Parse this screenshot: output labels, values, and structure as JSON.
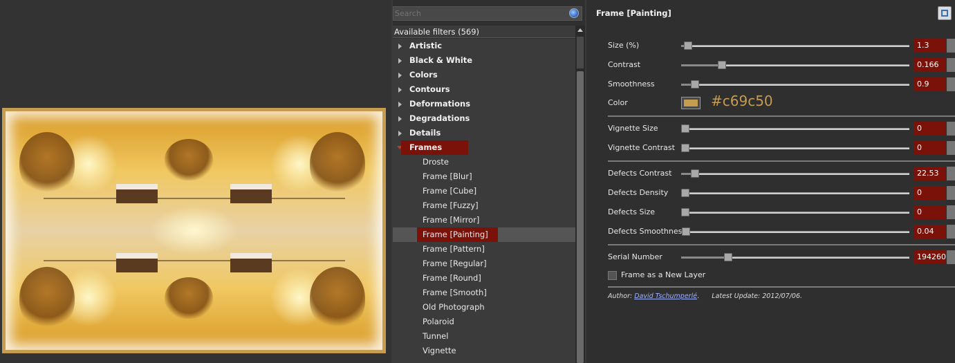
{
  "search": {
    "placeholder": "Search"
  },
  "filters": {
    "header": "Available filters (569)",
    "categories": [
      {
        "label": "Artistic"
      },
      {
        "label": "Black & White"
      },
      {
        "label": "Colors"
      },
      {
        "label": "Contours"
      },
      {
        "label": "Deformations"
      },
      {
        "label": "Degradations"
      },
      {
        "label": "Details"
      },
      {
        "label": "Frames"
      }
    ],
    "frames_items": [
      {
        "label": "Droste"
      },
      {
        "label": "Frame [Blur]"
      },
      {
        "label": "Frame [Cube]"
      },
      {
        "label": "Frame [Fuzzy]"
      },
      {
        "label": "Frame [Mirror]"
      },
      {
        "label": "Frame [Painting]"
      },
      {
        "label": "Frame [Pattern]"
      },
      {
        "label": "Frame [Regular]"
      },
      {
        "label": "Frame [Round]"
      },
      {
        "label": "Frame [Smooth]"
      },
      {
        "label": "Old Photograph"
      },
      {
        "label": "Polaroid"
      },
      {
        "label": "Tunnel"
      },
      {
        "label": "Vignette"
      }
    ],
    "selected_category": "Frames",
    "selected_item": "Frame [Painting]"
  },
  "params": {
    "title": "Frame [Painting]",
    "size": {
      "label": "Size (%)",
      "value": "1.3",
      "level": 0.013
    },
    "contrast": {
      "label": "Contrast",
      "value": "0.166",
      "level": 0.166
    },
    "smoothness": {
      "label": "Smoothness",
      "value": "0.9",
      "level": 0.045
    },
    "color": {
      "label": "Color",
      "hex": "#c69c50"
    },
    "vignette_size": {
      "label": "Vignette Size",
      "value": "0",
      "level": 0
    },
    "vignette_contrast": {
      "label": "Vignette Contrast",
      "value": "0",
      "level": 0
    },
    "defects_contrast": {
      "label": "Defects Contrast",
      "value": "22.53",
      "level": 0.045
    },
    "defects_density": {
      "label": "Defects Density",
      "value": "0",
      "level": 0
    },
    "defects_size": {
      "label": "Defects Size",
      "value": "0",
      "level": 0
    },
    "defects_smoothness": {
      "label": "Defects Smoothness",
      "value": "0.04",
      "level": 0.004
    },
    "serial_number": {
      "label": "Serial Number",
      "value": "194260",
      "level": 0.194
    },
    "new_layer": {
      "label": "Frame as a New Layer",
      "checked": false
    },
    "author_label": "Author:",
    "author_name": "David Tschumperlé",
    "author_sep": ".",
    "update_label": "Latest Update:",
    "update_value": "2012/07/06."
  },
  "colors": {
    "accent": "#7a120a",
    "frame_color": "#c69c50"
  },
  "icons": {
    "search": "search-icon",
    "expand": "triangle-right-icon",
    "collapse": "triangle-down-icon",
    "window": "window-restore-icon"
  }
}
